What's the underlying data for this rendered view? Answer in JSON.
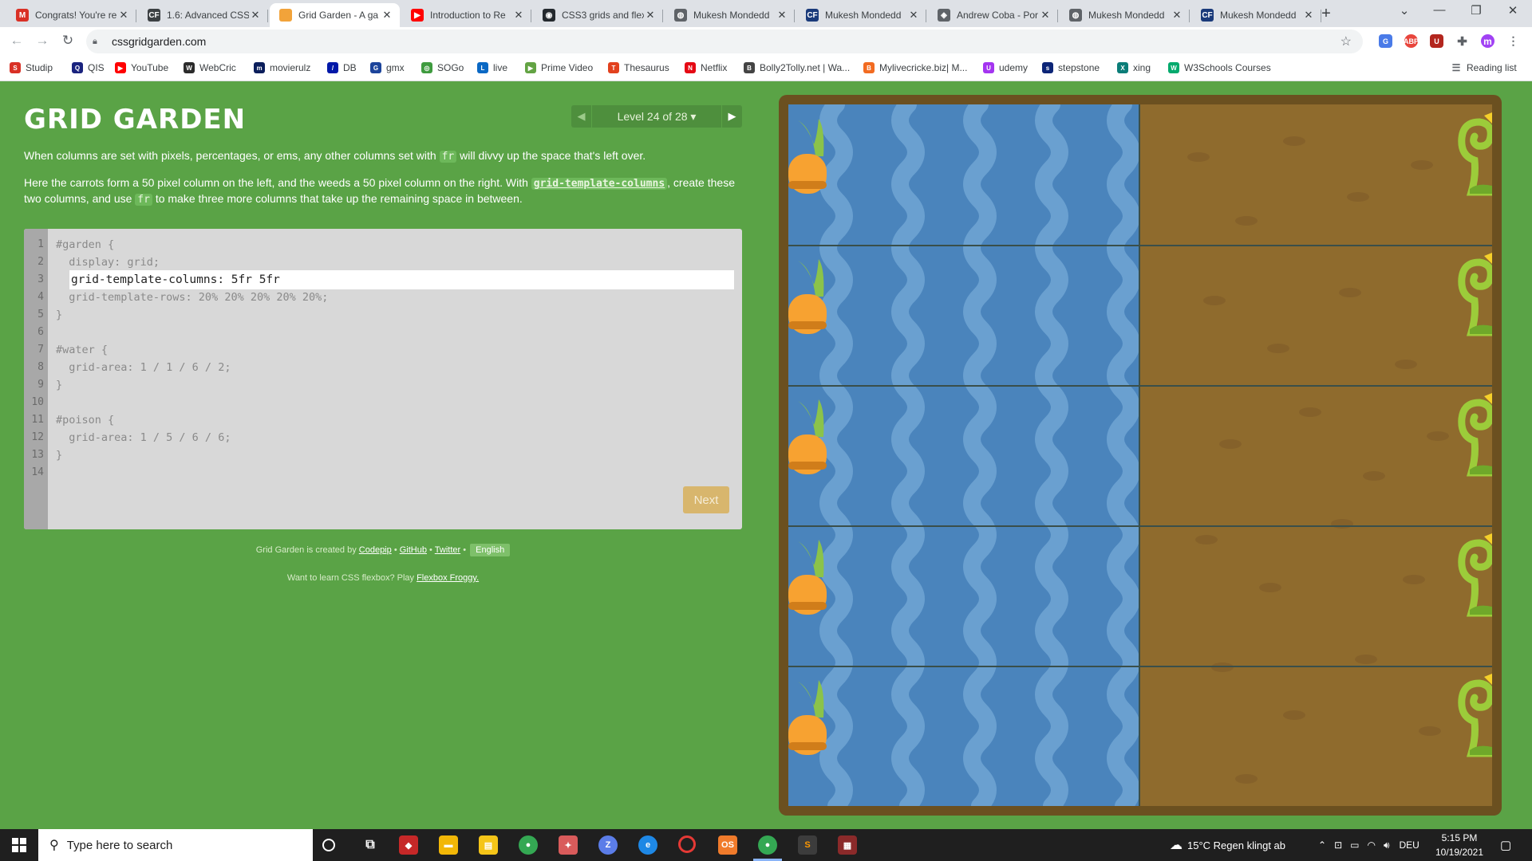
{
  "browser": {
    "tabs": [
      {
        "title": "Congrats! You're re",
        "icon": "gmail-icon",
        "color": "#d93025",
        "glyph": "M"
      },
      {
        "title": "1.6: Advanced CSS",
        "icon": "codefreaks-icon",
        "color": "#3c4043",
        "glyph": "CF"
      },
      {
        "title": "Grid Garden - A ga",
        "icon": "carrot-icon",
        "color": "#f2a33a",
        "glyph": ""
      },
      {
        "title": "Introduction to Re",
        "icon": "youtube-icon",
        "color": "#ff0000",
        "glyph": "▶"
      },
      {
        "title": "CSS3 grids and flex",
        "icon": "github-icon",
        "color": "#24292e",
        "glyph": "◉"
      },
      {
        "title": "Mukesh Mondedd",
        "icon": "globe-icon",
        "color": "#5f6368",
        "glyph": "◍"
      },
      {
        "title": "Mukesh Mondedd",
        "icon": "codefreaks-icon",
        "color": "#1a3a7a",
        "glyph": "CF"
      },
      {
        "title": "Andrew Coba - Por",
        "icon": "codepen-icon",
        "color": "#5f6368",
        "glyph": "◈"
      },
      {
        "title": "Mukesh Mondedd",
        "icon": "globe-icon",
        "color": "#5f6368",
        "glyph": "◍"
      },
      {
        "title": "Mukesh Mondedd",
        "icon": "codefreaks-icon",
        "color": "#1a3a7a",
        "glyph": "CF"
      }
    ],
    "url": "cssgridgarden.com",
    "bookmarks": [
      {
        "label": "Studip",
        "color": "#d93025",
        "glyph": "S"
      },
      {
        "label": "QIS",
        "color": "#1a237e",
        "glyph": "Q"
      },
      {
        "label": "YouTube",
        "color": "#ff0000",
        "glyph": "▶"
      },
      {
        "label": "WebCric",
        "color": "#2b2b2b",
        "glyph": "W"
      },
      {
        "label": "movierulz",
        "color": "#0b1e5b",
        "glyph": "m"
      },
      {
        "label": "DB",
        "color": "#0018a8",
        "glyph": "/"
      },
      {
        "label": "gmx",
        "color": "#1c449b",
        "glyph": "G"
      },
      {
        "label": "SOGo",
        "color": "#3f9b3f",
        "glyph": "◎"
      },
      {
        "label": "live",
        "color": "#0a68c4",
        "glyph": "L"
      },
      {
        "label": "Prime Video",
        "color": "#63a343",
        "glyph": "▶"
      },
      {
        "label": "Thesaurus",
        "color": "#e2411e",
        "glyph": "T"
      },
      {
        "label": "Netflix",
        "color": "#e50914",
        "glyph": "N"
      },
      {
        "label": "Bolly2Tolly.net | Wa...",
        "color": "#444",
        "glyph": "B"
      },
      {
        "label": "Mylivecricke.biz| M...",
        "color": "#f26b21",
        "glyph": "B"
      },
      {
        "label": "udemy",
        "color": "#a435f0",
        "glyph": "U"
      },
      {
        "label": "stepstone",
        "color": "#0c2577",
        "glyph": "s"
      },
      {
        "label": "xing",
        "color": "#0b7d78",
        "glyph": "X"
      },
      {
        "label": "W3Schools Courses",
        "color": "#04aa6d",
        "glyph": "W"
      }
    ],
    "reading_list": "Reading list",
    "profile_initial": "m"
  },
  "game": {
    "title": "GRID GARDEN",
    "level_indicator": "Level 24 of 28 ▾",
    "instruction_1": {
      "a": "When columns are set with pixels, percentages, or ems, any other columns set with",
      "code": "fr",
      "b": "will divvy up the space that's left over."
    },
    "instruction_2": {
      "a": "Here the carrots form a 50 pixel column on the left, and the weeds a 50 pixel column on the right. With",
      "code1": "grid-template-columns",
      "b": ", create these two columns, and use",
      "code2": "fr",
      "c": "to make three more columns that take up the remaining space in between."
    },
    "editor": {
      "line_numbers": [
        "1",
        "2",
        "3",
        "4",
        "5",
        "6",
        "7",
        "8",
        "9",
        "10",
        "11",
        "12",
        "13",
        "14"
      ],
      "lines": [
        "#garden {",
        "  display: grid;",
        "",
        "  grid-template-rows: 20% 20% 20% 20% 20%;",
        "}",
        "",
        "#water {",
        "  grid-area: 1 / 1 / 6 / 2;",
        "}",
        "",
        "#poison {",
        "  grid-area: 1 / 5 / 6 / 6;",
        "}",
        ""
      ],
      "answer_value": "grid-template-columns: 5fr 5fr",
      "next_label": "Next"
    },
    "credits": {
      "prefix": "Grid Garden is created by",
      "codepip": "Codepip",
      "github": "GitHub",
      "twitter": "Twitter",
      "language": "English",
      "sep": "•"
    },
    "promo": {
      "text": "Want to learn CSS flexbox? Play",
      "link": "Flexbox Froggy."
    }
  },
  "taskbar": {
    "search_placeholder": "Type here to search",
    "weather": "15°C  Regen klingt ab",
    "language": "DEU",
    "time": "5:15 PM",
    "date": "10/19/2021"
  }
}
